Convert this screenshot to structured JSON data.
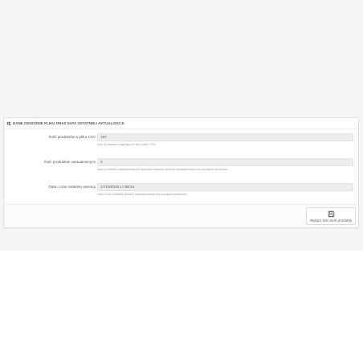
{
  "panel": {
    "title": "DANE ODNOŚNIE PLIKU ORAZ DATA OSTATNIEJ AKTUALIZACJI",
    "title_icon": "gears-icon"
  },
  "fields": [
    {
      "label": "Ilość produktów w pliku CSV",
      "value": "197",
      "help": "Ilość produktów znajdujących się w pliku CSV"
    },
    {
      "label": "Ilość produktów uaktualnionych",
      "value": "0",
      "help": "Ilość produktów zaktualizowanych podczas ostatniej operacji zaktualizowania lub usunięcia produktów"
    },
    {
      "label": "Data i czas ostatniej operacji",
      "value": "17/10/2019 17:58:34",
      "help": "Data i czas ostatniej operacji zaktualizowania lub usunięcia produktów"
    }
  ],
  "footer": {
    "button_label": "Wyłącz lub usuń produkty",
    "button_icon": "save-icon"
  },
  "colors": {
    "page_background": "#f5f5f5",
    "panel_background": "#ffffff",
    "field_background": "#eeeeee"
  }
}
